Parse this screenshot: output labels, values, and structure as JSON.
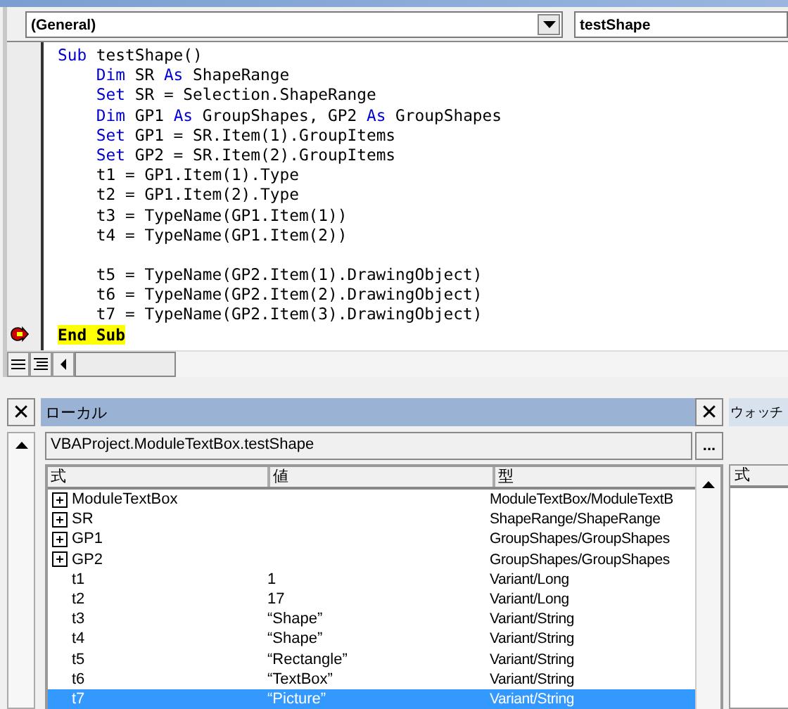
{
  "editor": {
    "object_box": "(General)",
    "procedure_box": "testShape",
    "lines": [
      {
        "kind": "code",
        "current": false,
        "segments": [
          {
            "kind": "kw",
            "text": "Sub"
          },
          {
            "kind": "plain",
            "text": " testShape()"
          }
        ]
      },
      {
        "kind": "code",
        "current": false,
        "segments": [
          {
            "kind": "kw",
            "text": "    Dim"
          },
          {
            "kind": "plain",
            "text": " SR "
          },
          {
            "kind": "kw",
            "text": "As"
          },
          {
            "kind": "plain",
            "text": " ShapeRange"
          }
        ]
      },
      {
        "kind": "code",
        "current": false,
        "segments": [
          {
            "kind": "kw",
            "text": "    Set"
          },
          {
            "kind": "plain",
            "text": " SR = Selection.ShapeRange"
          }
        ]
      },
      {
        "kind": "code",
        "current": false,
        "segments": [
          {
            "kind": "kw",
            "text": "    Dim"
          },
          {
            "kind": "plain",
            "text": " GP1 "
          },
          {
            "kind": "kw",
            "text": "As"
          },
          {
            "kind": "plain",
            "text": " GroupShapes, GP2 "
          },
          {
            "kind": "kw",
            "text": "As"
          },
          {
            "kind": "plain",
            "text": " GroupShapes"
          }
        ]
      },
      {
        "kind": "code",
        "current": false,
        "segments": [
          {
            "kind": "kw",
            "text": "    Set"
          },
          {
            "kind": "plain",
            "text": " GP1 = SR.Item(1).GroupItems"
          }
        ]
      },
      {
        "kind": "code",
        "current": false,
        "segments": [
          {
            "kind": "kw",
            "text": "    Set"
          },
          {
            "kind": "plain",
            "text": " GP2 = SR.Item(2).GroupItems"
          }
        ]
      },
      {
        "kind": "code",
        "current": false,
        "segments": [
          {
            "kind": "plain",
            "text": "    t1 = GP1.Item(1).Type"
          }
        ]
      },
      {
        "kind": "code",
        "current": false,
        "segments": [
          {
            "kind": "plain",
            "text": "    t2 = GP1.Item(2).Type"
          }
        ]
      },
      {
        "kind": "code",
        "current": false,
        "segments": [
          {
            "kind": "plain",
            "text": "    t3 = TypeName(GP1.Item(1))"
          }
        ]
      },
      {
        "kind": "code",
        "current": false,
        "segments": [
          {
            "kind": "plain",
            "text": "    t4 = TypeName(GP1.Item(2))"
          }
        ]
      },
      {
        "kind": "blank",
        "current": false
      },
      {
        "kind": "code",
        "current": false,
        "segments": [
          {
            "kind": "plain",
            "text": "    t5 = TypeName(GP2.Item(1).DrawingObject)"
          }
        ]
      },
      {
        "kind": "code",
        "current": false,
        "segments": [
          {
            "kind": "plain",
            "text": "    t6 = TypeName(GP2.Item(2).DrawingObject)"
          }
        ]
      },
      {
        "kind": "code",
        "current": false,
        "segments": [
          {
            "kind": "plain",
            "text": "    t7 = TypeName(GP2.Item(3).DrawingObject)"
          }
        ]
      },
      {
        "kind": "code",
        "current": true,
        "segments": [
          {
            "kind": "kw",
            "text": "End Sub"
          }
        ]
      }
    ]
  },
  "locals": {
    "title": "ローカル",
    "context": "VBAProject.ModuleTextBox.testShape",
    "context_button": "...",
    "columns": [
      "式",
      "値",
      "型"
    ],
    "rows": [
      {
        "kind": "node",
        "expanded": false,
        "selected": false,
        "name": "ModuleTextBox",
        "type": "ModuleTextBox/ModuleTextB"
      },
      {
        "kind": "node",
        "expanded": false,
        "selected": false,
        "name": "SR",
        "type": "ShapeRange/ShapeRange"
      },
      {
        "kind": "node",
        "expanded": false,
        "selected": false,
        "name": "GP1",
        "type": "GroupShapes/GroupShapes"
      },
      {
        "kind": "node",
        "expanded": false,
        "selected": false,
        "name": "GP2",
        "type": "GroupShapes/GroupShapes"
      },
      {
        "kind": "leaf",
        "selected": false,
        "name": "t1",
        "value": "1",
        "type": "Variant/Long"
      },
      {
        "kind": "leaf",
        "selected": false,
        "name": "t2",
        "value": "17",
        "type": "Variant/Long"
      },
      {
        "kind": "leaf",
        "selected": false,
        "name": "t3",
        "value": "“Shape”",
        "type": "Variant/String"
      },
      {
        "kind": "leaf",
        "selected": false,
        "name": "t4",
        "value": "“Shape”",
        "type": "Variant/String"
      },
      {
        "kind": "leaf",
        "selected": false,
        "name": "t5",
        "value": "“Rectangle”",
        "type": "Variant/String"
      },
      {
        "kind": "leaf",
        "selected": false,
        "name": "t6",
        "value": "“TextBox”",
        "type": "Variant/String"
      },
      {
        "kind": "leaf",
        "selected": true,
        "name": "t7",
        "value": "“Picture”",
        "type": "Variant/String"
      }
    ]
  },
  "watch": {
    "title": "ウォッチ",
    "column": "式"
  },
  "close_button": "✕"
}
